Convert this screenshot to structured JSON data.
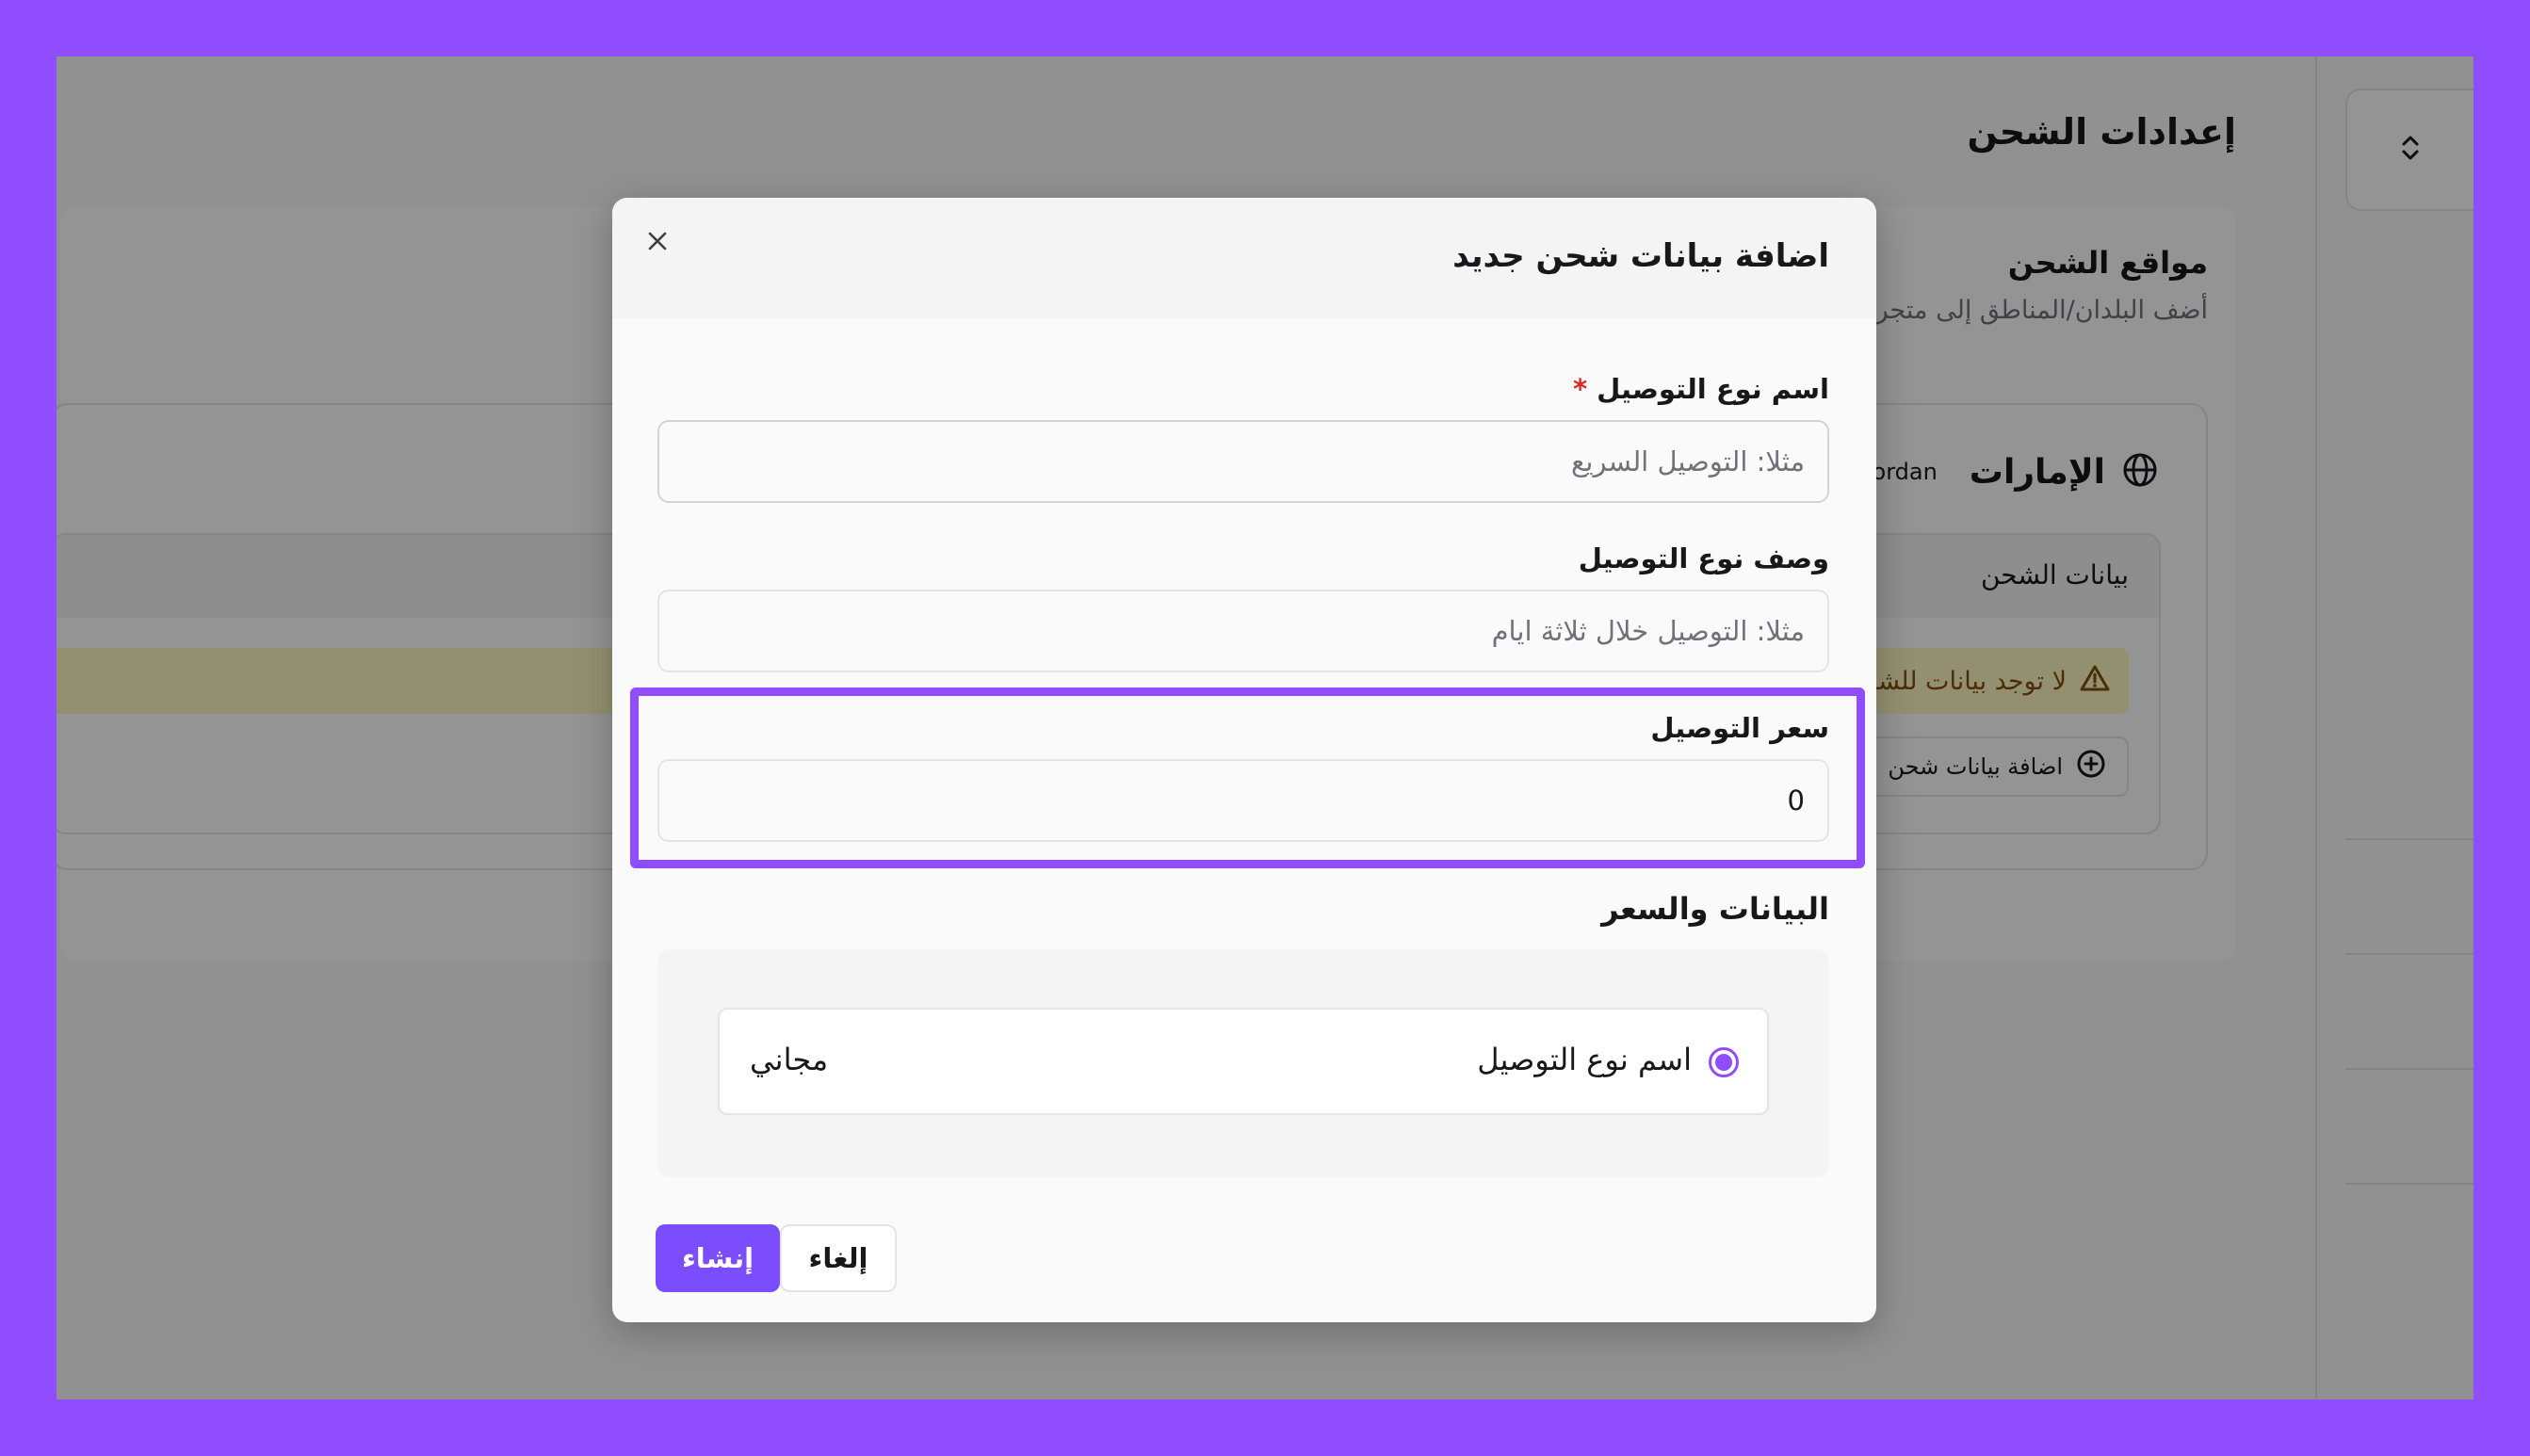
{
  "page": {
    "title": "إعدادات الشحن",
    "section_title": "مواقع الشحن",
    "section_subtitle": "أضف البلدان/المناطق إلى متجرك",
    "zone_name": "الإمارات",
    "zone_countries": "es Jordan",
    "rates_header": "بيانات الشحن",
    "no_rates_warning": "لا توجد بيانات للشحن",
    "add_rate_label": "اضافة بيانات شحن"
  },
  "modal": {
    "title": "اضافة بيانات شحن جديد",
    "name_label": "اسم نوع التوصيل",
    "required_mark": "*",
    "name_placeholder": "مثلا: التوصيل السريع",
    "description_label": "وصف نوع التوصيل",
    "description_placeholder": "مثلا: التوصيل خلال ثلاثة ايام",
    "price_label": "سعر التوصيل",
    "price_value": "0",
    "preview_title": "البيانات والسعر",
    "preview_name": "اسم نوع التوصيل",
    "preview_price": "مجاني",
    "create_label": "إنشاء",
    "cancel_label": "إلغاء"
  },
  "icons": {
    "close": "close-icon",
    "globe": "globe-icon",
    "warning": "warning-icon",
    "add": "plus-circle-icon",
    "toggle": "chevron-up-down-icon"
  },
  "colors": {
    "accent": "#8F4DFF",
    "primary_button": "#7C4DFF",
    "required": "#DC2626",
    "warning_bg": "#FEF9C3",
    "warning_text": "#854D0E"
  }
}
